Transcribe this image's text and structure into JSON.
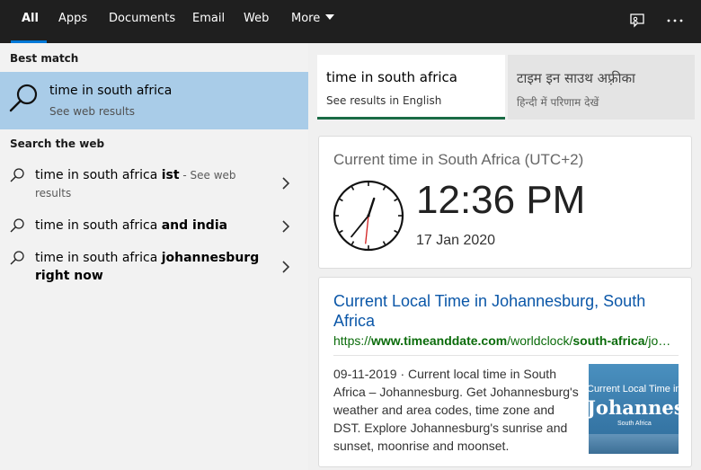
{
  "tabs": [
    {
      "label": "All",
      "active": true
    },
    {
      "label": "Apps"
    },
    {
      "label": "Documents"
    },
    {
      "label": "Email"
    },
    {
      "label": "Web"
    },
    {
      "label": "More"
    }
  ],
  "topbar_icons": [
    "feedback-icon",
    "more-options-icon"
  ],
  "best_match": {
    "heading": "Best match",
    "title": "time in south africa",
    "subtitle": "See web results",
    "icon": "search-icon"
  },
  "search_web": {
    "heading": "Search the web",
    "suggestions": [
      {
        "base": "time in south africa ",
        "bold": "ist",
        "suffix": " - See web results"
      },
      {
        "base": "time in south africa ",
        "bold": "and india",
        "suffix": ""
      },
      {
        "base": "time in south africa ",
        "bold": "johannesburg right now",
        "suffix": ""
      }
    ]
  },
  "language_cards": {
    "english": {
      "title": "time in south africa",
      "subtitle": "See results in English"
    },
    "hindi": {
      "title": "टाइम इन साउथ अफ़्रीका",
      "subtitle": "हिन्दी में परिणाम देखें"
    }
  },
  "time_card": {
    "heading": "Current time in South Africa (UTC+2)",
    "time": "12:36 PM",
    "date": "17 Jan 2020",
    "clock": {
      "hour": 12,
      "minute": 36,
      "second": 31
    }
  },
  "result": {
    "title": "Current Local Time in Johannesburg, South Africa",
    "url_parts": [
      {
        "text": "https://",
        "bold": false
      },
      {
        "text": "www.timeanddate.com",
        "bold": true
      },
      {
        "text": "/worldclock/",
        "bold": false
      },
      {
        "text": "south-africa",
        "bold": true
      },
      {
        "text": "/johannesburg",
        "bold": false
      }
    ],
    "snippet": "09-11-2019 · Current local time in South Africa – Johannesburg. Get Johannesburg's weather and area codes, time zone and DST. Explore Johannesburg's sunrise and sunset, moonrise and moonset.",
    "thumbnail": {
      "line1": "Current Local Time in",
      "line2": "Johannesburg",
      "line3": "South Africa"
    }
  },
  "colors": {
    "topbar_bg": "#1f1f1f",
    "accent": "#0078d7",
    "best_match_bg": "#a9cce8",
    "link": "#0b57a8",
    "url_green": "#0a6b0a"
  }
}
